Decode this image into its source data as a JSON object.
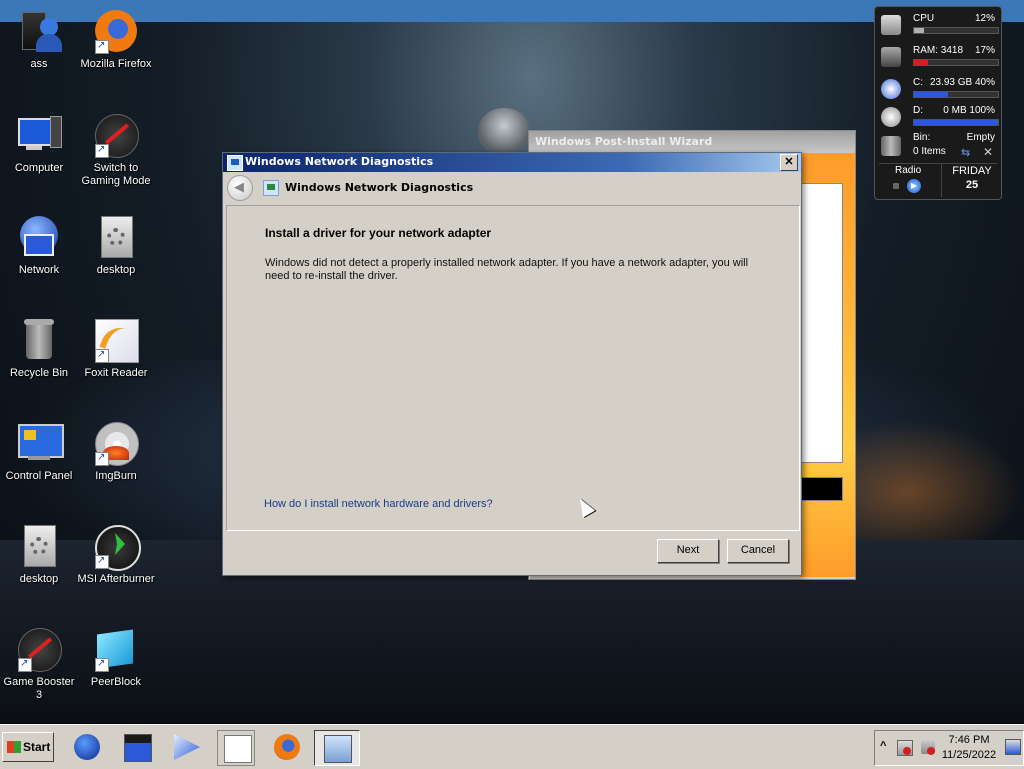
{
  "desktop": {
    "icons": [
      {
        "label": "ass",
        "icon": "user-icon"
      },
      {
        "label": "Mozilla Firefox",
        "icon": "firefox-icon"
      },
      {
        "label": "Computer",
        "icon": "computer-icon"
      },
      {
        "label": "Switch to Gaming Mode",
        "icon": "gaming-mode-icon"
      },
      {
        "label": "Network",
        "icon": "network-icon"
      },
      {
        "label": "desktop",
        "icon": "gear-file-icon"
      },
      {
        "label": "Recycle Bin",
        "icon": "recycle-bin-icon"
      },
      {
        "label": "Foxit Reader",
        "icon": "foxit-icon"
      },
      {
        "label": "Control Panel",
        "icon": "control-panel-icon"
      },
      {
        "label": "ImgBurn",
        "icon": "imgburn-icon"
      },
      {
        "label": "desktop",
        "icon": "gear-file-icon"
      },
      {
        "label": "MSI Afterburner",
        "icon": "afterburner-icon"
      },
      {
        "label": "Game Booster 3",
        "icon": "game-booster-icon"
      },
      {
        "label": "PeerBlock",
        "icon": "peerblock-icon"
      }
    ]
  },
  "gadget": {
    "cpu_label": "CPU",
    "cpu_value": "12%",
    "cpu_fill": 0.12,
    "ram_label": "RAM: 3418",
    "ram_value": "17%",
    "ram_fill": 0.17,
    "c_label": "C:",
    "c_value": "23.93 GB 40%",
    "c_fill": 0.4,
    "d_label": "D:",
    "d_value": "0 MB 100%",
    "d_fill": 1.0,
    "bin_label": "Bin:",
    "bin_status": "Empty",
    "bin_items": "0 Items",
    "radio_label": "Radio",
    "day": "FRIDAY",
    "date": "25",
    "colors": {
      "cpu": "#b0b0b0",
      "ram": "#d02020",
      "disk": "#2a5ad8"
    }
  },
  "wizard": {
    "title": "Windows Post-Install Wizard"
  },
  "dialog": {
    "title": "Windows Network Diagnostics",
    "header_title": "Windows Network Diagnostics",
    "heading": "Install a driver for your network adapter",
    "body": "Windows did not detect a properly installed network adapter. If you have a network adapter, you will need to re-install the driver.",
    "link": "How do I install network hardware and drivers?",
    "next_label": "Next",
    "cancel_label": "Cancel",
    "close_glyph": "✕"
  },
  "taskbar": {
    "start_label": "Start",
    "items": [
      {
        "icon": "globe-icon"
      },
      {
        "icon": "window-app-icon"
      },
      {
        "icon": "media-player-icon"
      },
      {
        "icon": "document-window-icon"
      },
      {
        "icon": "firefox-icon"
      },
      {
        "icon": "network-diagnostics-icon"
      }
    ],
    "tray_chevron": "^",
    "clock_time": "7:46 PM",
    "clock_date": "11/25/2022"
  }
}
